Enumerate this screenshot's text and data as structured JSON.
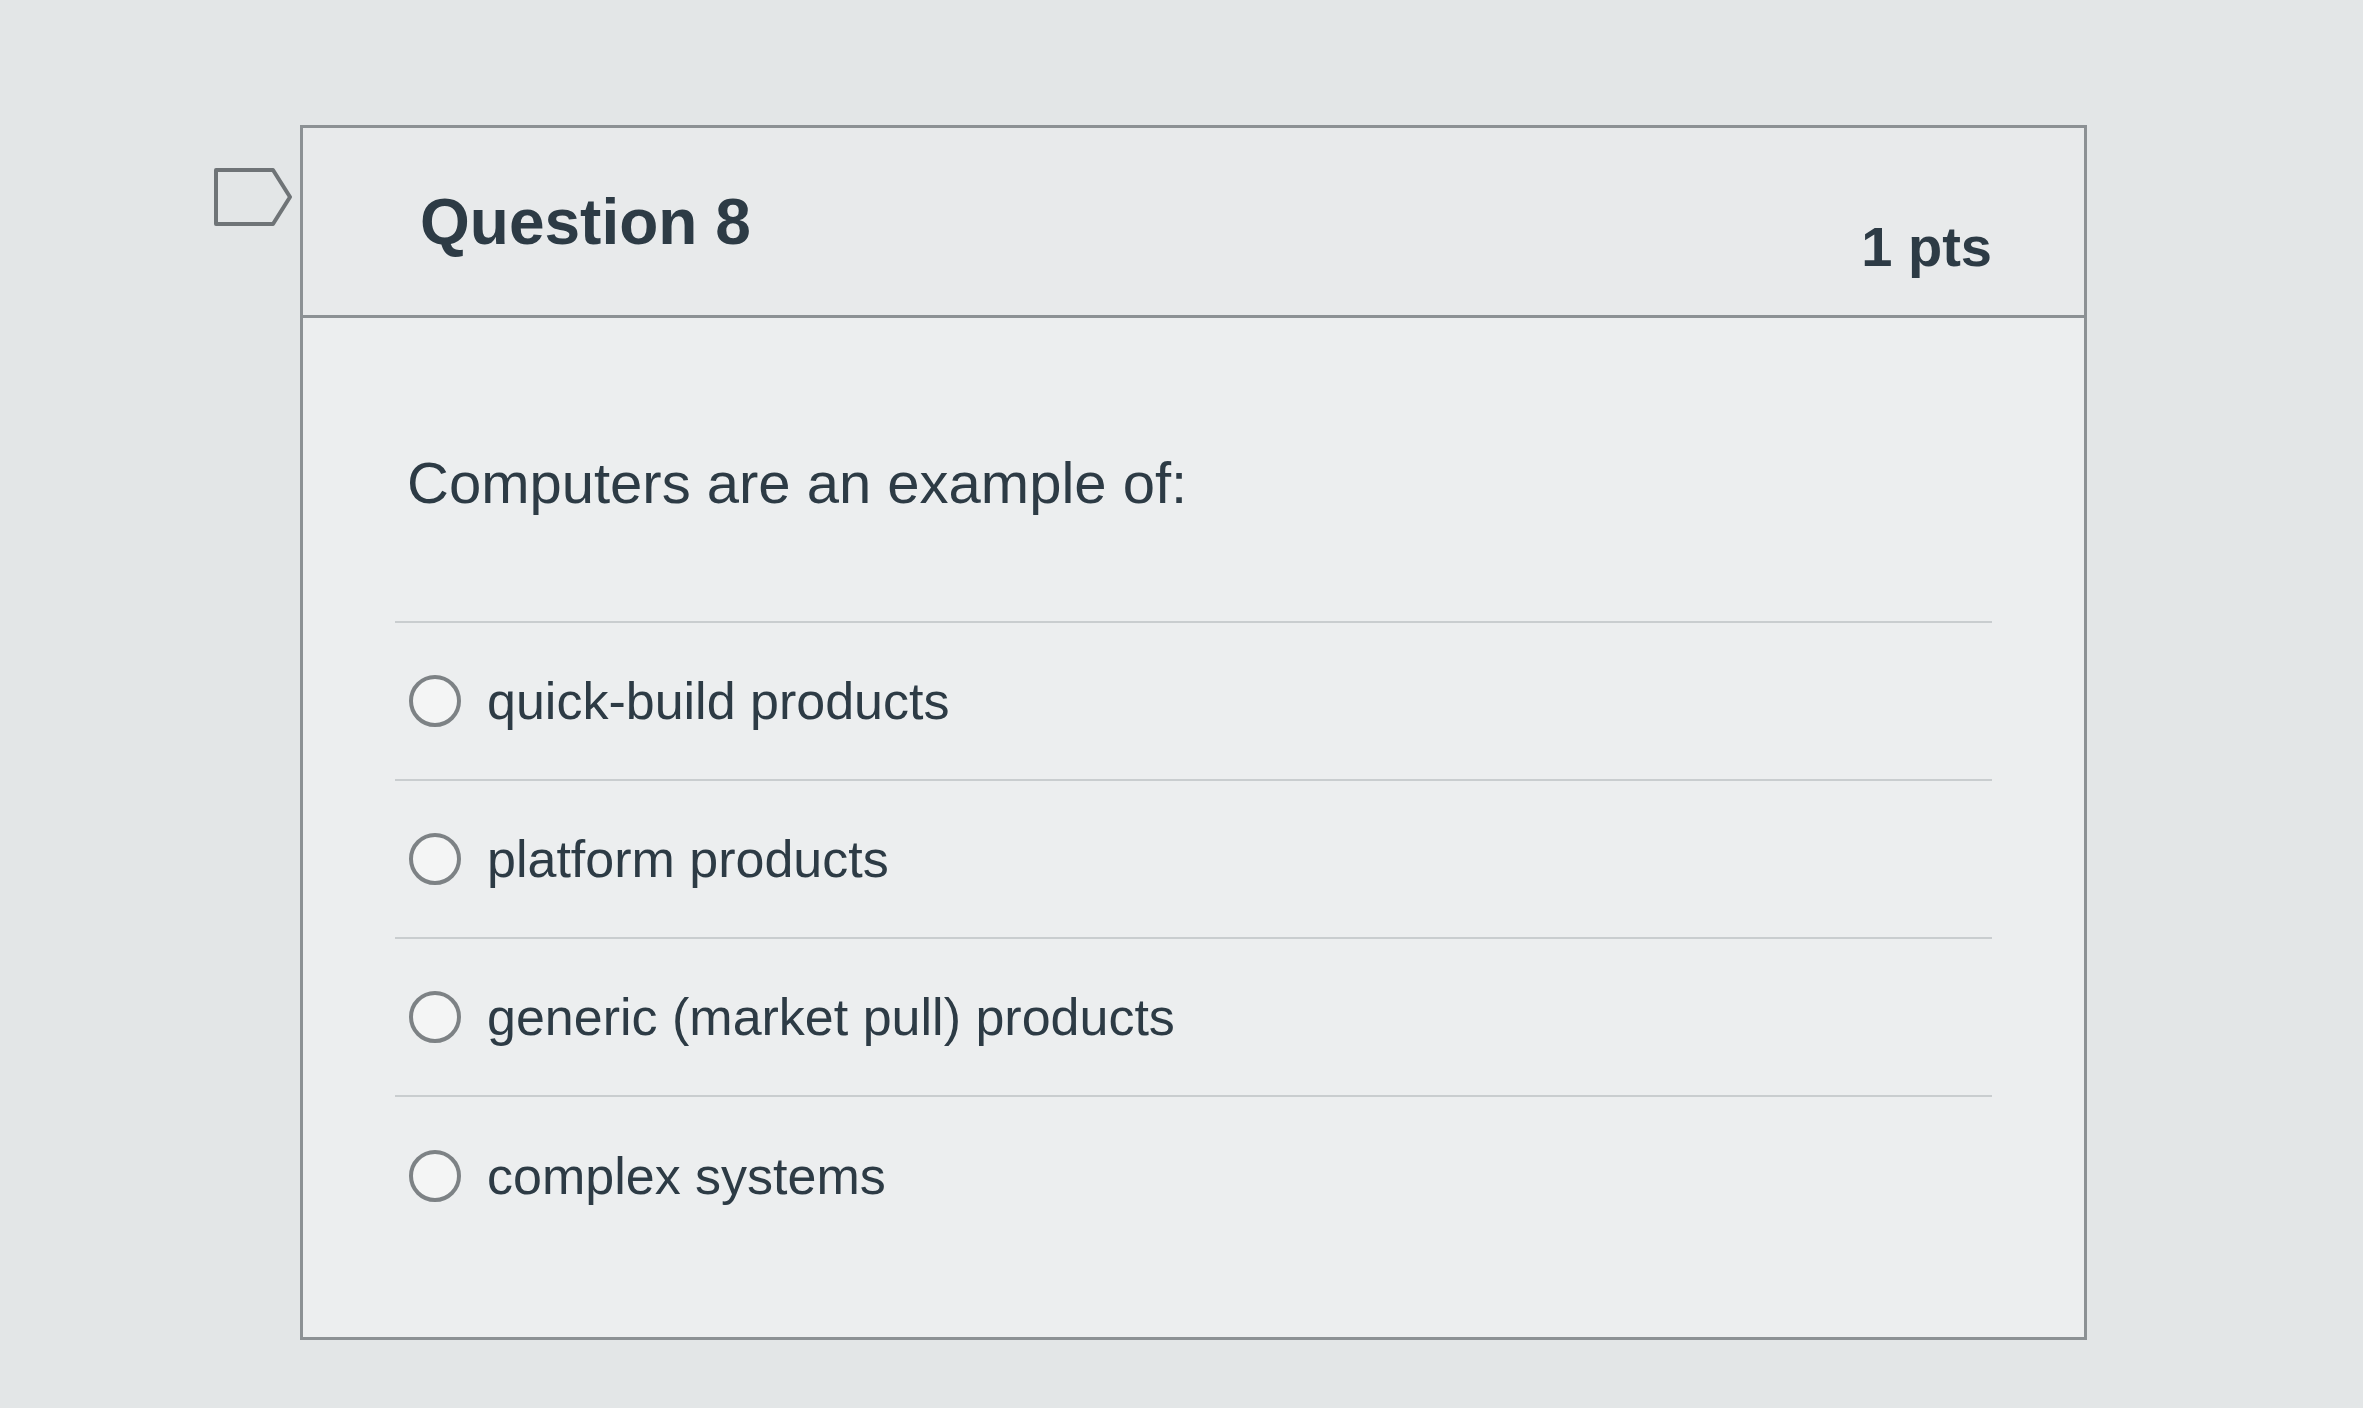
{
  "question": {
    "flagged": false,
    "title": "Question 8",
    "points": "1 pts",
    "prompt": "Computers are an example of:",
    "options": [
      {
        "label": "quick-build products",
        "selected": false
      },
      {
        "label": "platform products",
        "selected": false
      },
      {
        "label": "generic (market pull) products",
        "selected": false
      },
      {
        "label": "complex systems",
        "selected": false
      }
    ]
  }
}
